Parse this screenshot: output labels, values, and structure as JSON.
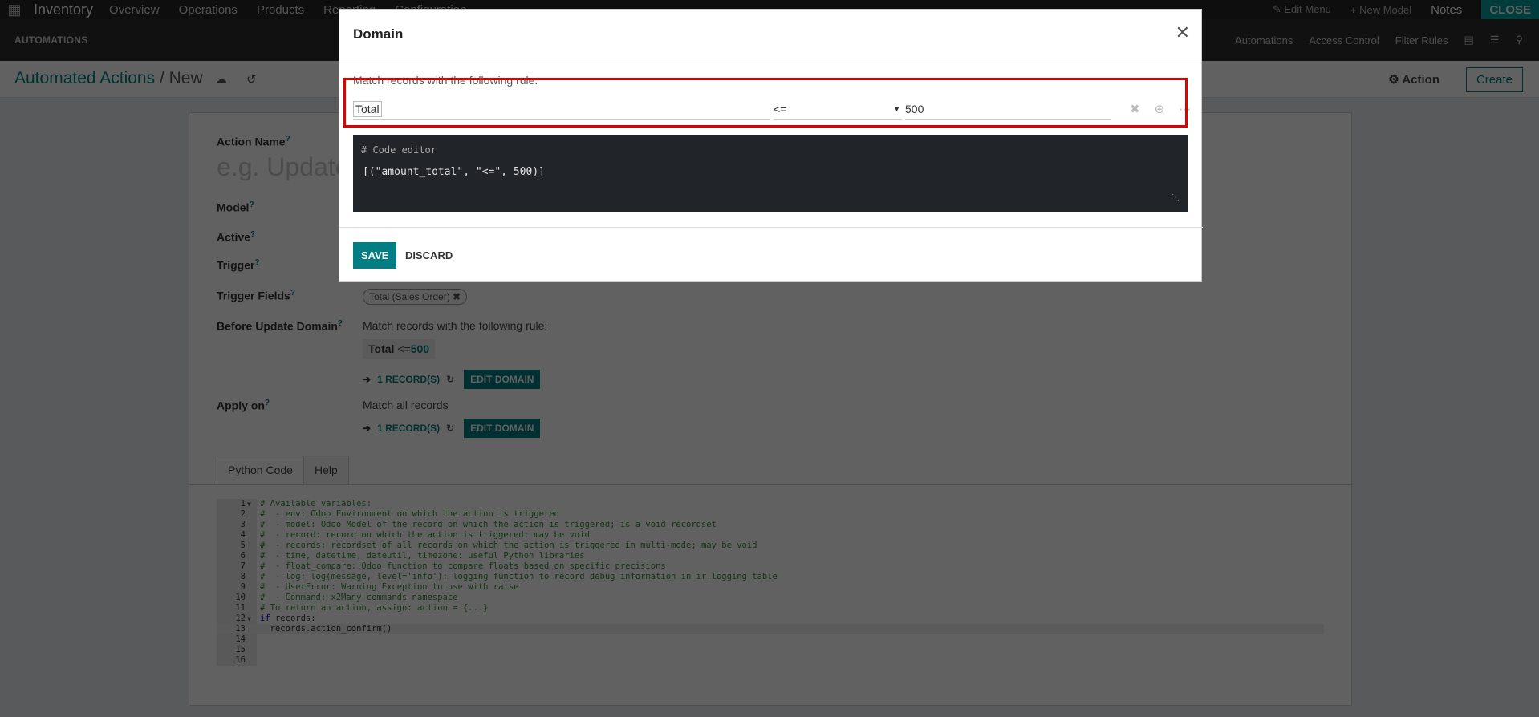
{
  "topbar": {
    "app": "Inventory",
    "menus": [
      "Overview",
      "Operations",
      "Products",
      "Reporting",
      "Configuration"
    ],
    "edit_menu": "Edit Menu",
    "new_model": "New Model",
    "notes": "Notes",
    "close": "CLOSE"
  },
  "subbar": {
    "title": "AUTOMATIONS",
    "links": [
      "Automations",
      "Access Control",
      "Filter Rules"
    ]
  },
  "control": {
    "breadcrumb_parent": "Automated Actions",
    "breadcrumb_sep": "/",
    "breadcrumb_current": "New",
    "action": "Action",
    "create": "Create"
  },
  "form": {
    "labels": [
      "Action Name",
      "Model",
      "Active",
      "Trigger",
      "Trigger Fields",
      "Before Update Domain",
      "Apply on"
    ],
    "name_placeholder": "e.g. Update order quantity",
    "trigger_tag": "Total (Sales Order)",
    "before_rule_text": "Match records with the following rule:",
    "chip_field": "Total",
    "chip_op": "<=",
    "chip_val": "500",
    "records": "1 RECORD(S)",
    "edit_domain": "EDIT DOMAIN",
    "apply_on_text": "Match all records",
    "tabs": [
      "Python Code",
      "Help"
    ]
  },
  "code_lines": [
    "# Available variables:",
    "#  - env: Odoo Environment on which the action is triggered",
    "#  - model: Odoo Model of the record on which the action is triggered; is a void recordset",
    "#  - record: record on which the action is triggered; may be void",
    "#  - records: recordset of all records on which the action is triggered in multi-mode; may be void",
    "#  - time, datetime, dateutil, timezone: useful Python libraries",
    "#  - float_compare: Odoo function to compare floats based on specific precisions",
    "#  - log: log(message, level='info'): logging function to record debug information in ir.logging table",
    "#  - UserError: Warning Exception to use with raise",
    "#  - Command: x2Many commands namespace",
    "# To return an action, assign: action = {...}",
    "if records:",
    "  records.action_confirm()",
    "",
    "",
    ""
  ],
  "modal": {
    "title": "Domain",
    "rule_text": "Match records with the following rule:",
    "field": "Total",
    "operator": "<=",
    "value": "500",
    "editor_comment": "# Code editor",
    "editor_value": "[(\"amount_total\", \"<=\", 500)]",
    "save": "SAVE",
    "discard": "DISCARD"
  }
}
